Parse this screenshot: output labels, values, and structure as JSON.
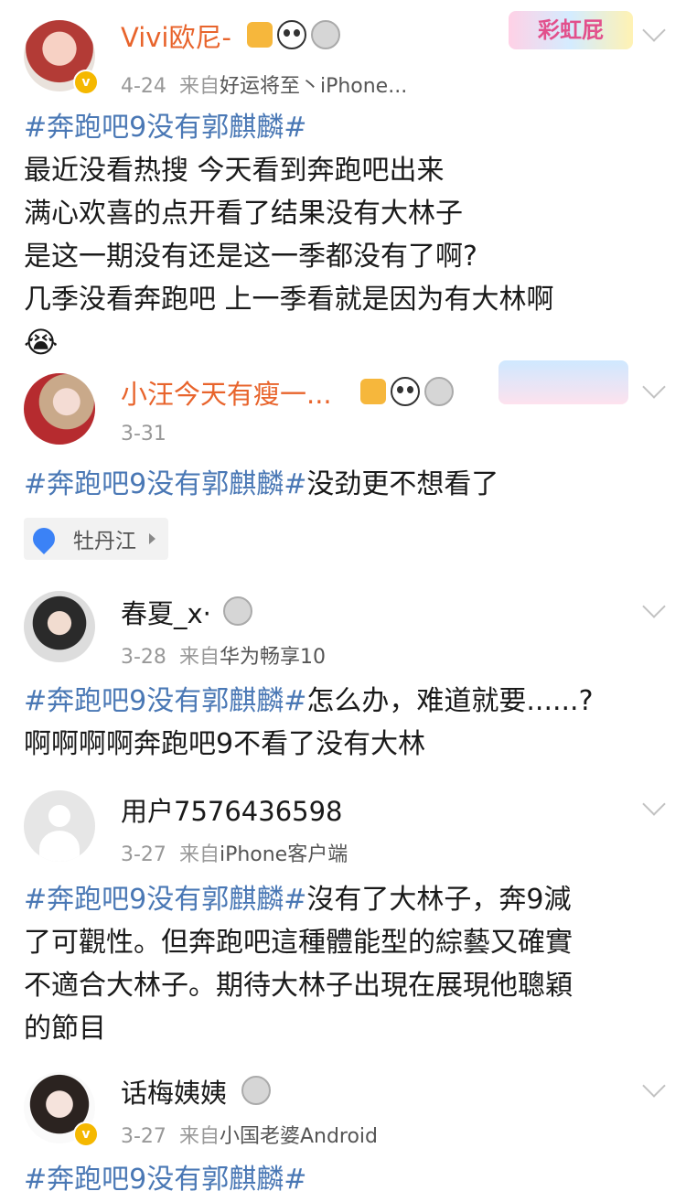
{
  "posts": [
    {
      "name": "Vivi欧尼-",
      "date": "4-24",
      "from": "来自",
      "source": "好运将至丶iPhone...",
      "badge_text": "彩虹屁",
      "lines": [
        {
          "tag": "#奔跑吧9没有郭麒麟#",
          "text": ""
        },
        {
          "tag": "",
          "text": "最近没看热搜 今天看到奔跑吧出来"
        },
        {
          "tag": "",
          "text": "满心欢喜的点开看了结果没有大林子"
        },
        {
          "tag": "",
          "text": "是这一期没有还是这一季都没有了啊?"
        },
        {
          "tag": "",
          "text": "几季没看奔跑吧 上一季看就是因为有大林啊"
        }
      ],
      "emoji": "😭"
    },
    {
      "name": "小汪今天有瘦一...",
      "date": "3-31",
      "lines": [
        {
          "tag": "#奔跑吧9没有郭麒麟#",
          "text": "没劲更不想看了"
        }
      ],
      "location": "牡丹江"
    },
    {
      "name": "春夏_x·",
      "date": "3-28",
      "from": "来自",
      "source": "华为畅享10",
      "lines": [
        {
          "tag": "#奔跑吧9没有郭麒麟#",
          "text": "怎么办，难道就要......?"
        },
        {
          "tag": "",
          "text": "啊啊啊啊奔跑吧9不看了没有大林"
        }
      ]
    },
    {
      "name": "用户7576436598",
      "date": "3-27",
      "from": "来自",
      "source": "iPhone客户端",
      "lines": [
        {
          "tag": "#奔跑吧9没有郭麒麟#",
          "text": "沒有了大林子，奔9減"
        },
        {
          "tag": "",
          "text": "了可觀性。但奔跑吧這種體能型的綜藝又確實"
        },
        {
          "tag": "",
          "text": "不適合大林子。期待大林子出現在展現他聰穎"
        },
        {
          "tag": "",
          "text": "的節目"
        }
      ]
    },
    {
      "name": "话梅姨姨",
      "date": "3-27",
      "from": "来自",
      "source": "小国老婆Android",
      "lines": [
        {
          "tag": "#奔跑吧9没有郭麒麟#",
          "text": ""
        }
      ]
    }
  ],
  "colors": {
    "tag": "#4a78b5",
    "vip_name": "#e8642c",
    "meta": "#999999"
  },
  "icons": [
    "crown-icon",
    "panda-icon",
    "medal-icon",
    "chevron-down-icon",
    "location-pin-icon",
    "verified-icon"
  ]
}
